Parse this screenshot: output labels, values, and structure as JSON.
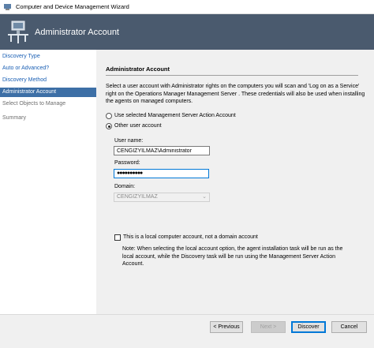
{
  "window": {
    "title": "Computer and Device Management Wizard"
  },
  "banner": {
    "title": "Administrator Account"
  },
  "nav": {
    "items": [
      {
        "label": "Discovery Type"
      },
      {
        "label": "Auto or Advanced?"
      },
      {
        "label": "Discovery Method"
      },
      {
        "label": "Administrator Account"
      },
      {
        "label": "Select Objects to Manage"
      },
      {
        "label": "Summary"
      }
    ]
  },
  "page": {
    "heading": "Administrator Account",
    "description": "Select a user account with Administrator rights on the computers you will scan and 'Log on as a Service' right on the Operations Manager Management Server . These credentials will also be used when installing the agents on managed computers.",
    "radio_action_account": "Use selected Management Server Action Account",
    "radio_other_account": "Other user account",
    "username_label": "User name:",
    "username_value": "CENGIZYILMAZ\\Administrator",
    "password_label": "Password:",
    "password_value": "●●●●●●●●●●",
    "domain_label": "Domain:",
    "domain_value": "CENGIZYILMAZ",
    "local_account_label": "This is a local computer account, not a domain account",
    "note": "Note:  When selecting the local account option, the agent installation task will be run as the local account, while the Discovery task will be run using the Management Server Action Account."
  },
  "buttons": {
    "previous": "< Previous",
    "next": "Next >",
    "discover": "Discover",
    "cancel": "Cancel"
  }
}
